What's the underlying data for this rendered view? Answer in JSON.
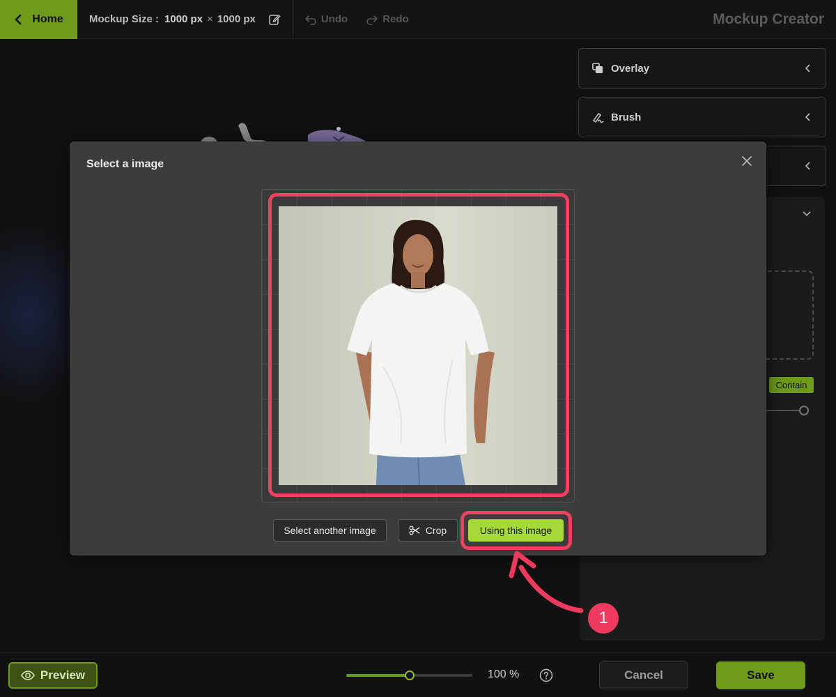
{
  "topbar": {
    "home_label": "Home",
    "mockup_size_label": "Mockup Size :",
    "width_value": "1000 px",
    "times": "×",
    "height_value": "1000 px",
    "undo_label": "Undo",
    "redo_label": "Redo",
    "app_title": "Mockup Creator"
  },
  "right_panel": {
    "accordions": [
      {
        "label": "Overlay",
        "icon": "layers-icon"
      },
      {
        "label": "Brush",
        "icon": "brush-icon"
      },
      {
        "label": "",
        "icon": ""
      }
    ],
    "contain_label": "Contain"
  },
  "modal": {
    "title": "Select a image",
    "select_another_label": "Select another image",
    "crop_label": "Crop",
    "use_image_label": "Using this image"
  },
  "annotation": {
    "step_number": "1",
    "accent_color": "#ef3a5d"
  },
  "bottombar": {
    "preview_label": "Preview",
    "zoom_label": "100 %",
    "zoom_fraction": 0.5,
    "cancel_label": "Cancel",
    "save_label": "Save"
  },
  "colors": {
    "brand_green": "#6e9b19",
    "action_green": "#a4d936",
    "highlight_red": "#f2415f",
    "modal_bg": "#3c3c3c",
    "page_bg": "#111111"
  }
}
